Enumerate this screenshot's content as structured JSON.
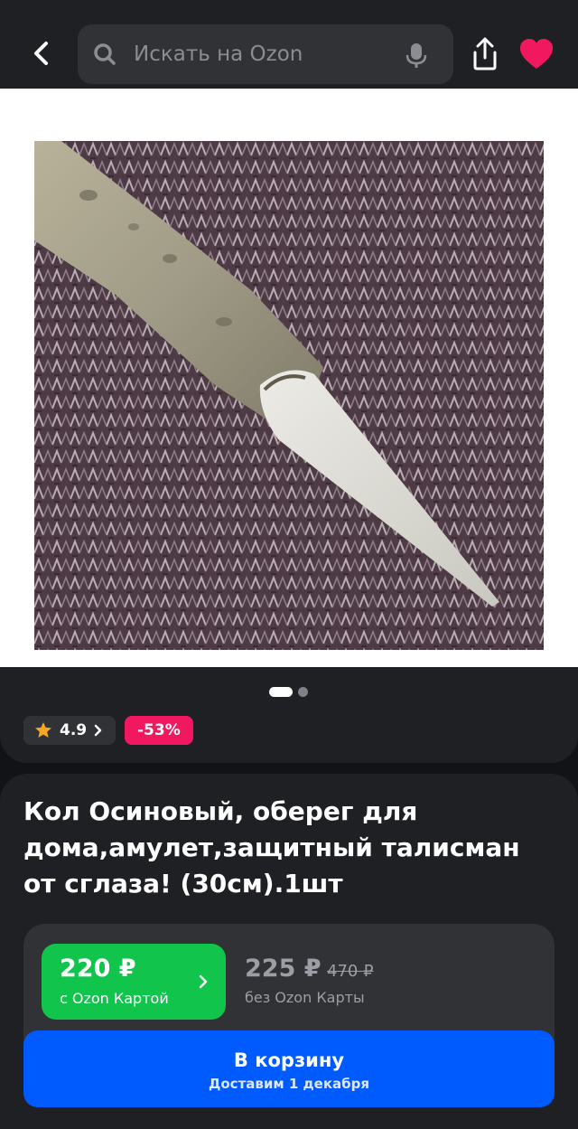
{
  "search": {
    "placeholder": "Искать на Ozon"
  },
  "icons": {
    "back": "chevron-left-icon",
    "search": "magnifier-icon",
    "mic": "microphone-icon",
    "share": "share-icon",
    "favorite": "heart-icon",
    "visual_search": "visual-search-icon",
    "rating": "star-icon"
  },
  "colors": {
    "favorite": "#f1185f",
    "discount": "#f1185f",
    "ozon_card_price": "#10c44c",
    "cart_button": "#005bff",
    "rating_star": "#f5a623"
  },
  "carousel": {
    "total": 2,
    "active": 1
  },
  "rating": {
    "value": "4.9"
  },
  "discount": {
    "label": "-53%"
  },
  "product": {
    "title": "Кол Осиновый, оберег для дома,амулет,защитный талисман от сглаза! (30см).1шт"
  },
  "price": {
    "ozon_card_price": "220 ₽",
    "ozon_card_label": "с Ozon Картой",
    "regular_price": "225 ₽",
    "old_price": "470 ₽",
    "regular_label": "без Ozon Карты"
  },
  "cart": {
    "label": "В корзину",
    "delivery": "Доставим 1 декабря"
  }
}
